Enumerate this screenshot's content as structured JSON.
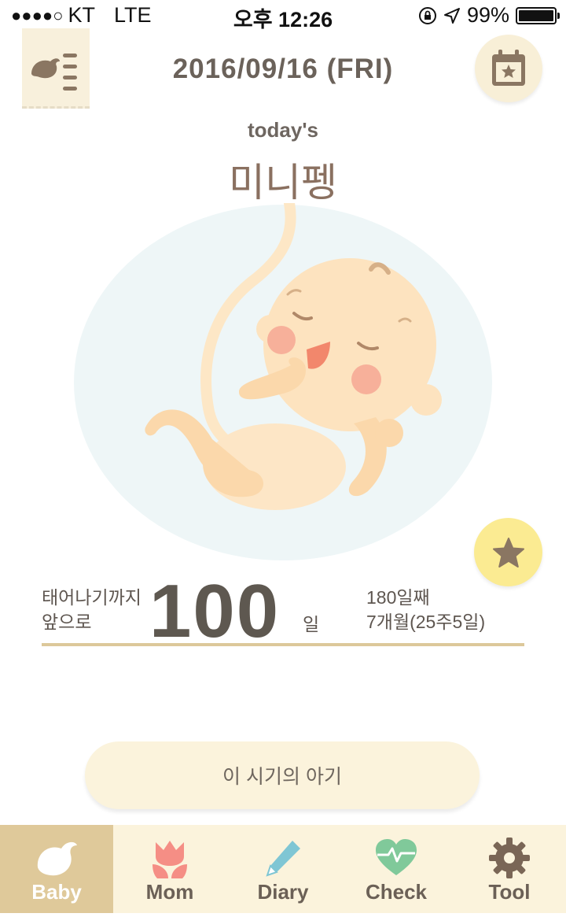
{
  "status_bar": {
    "signal": "●●●●○",
    "carrier": "KT",
    "network": "LTE",
    "time": "오후 12:26",
    "battery": "99%"
  },
  "header": {
    "date": "2016/09/16 (FRI)",
    "menu_icon": "bird-menu-icon",
    "calendar_icon": "calendar-star-icon"
  },
  "hero": {
    "todays_label": "today's",
    "baby_name": "미니펭"
  },
  "counter": {
    "left_line1": "태어나기까지",
    "left_line2": "앞으로",
    "value": "100",
    "unit": "일",
    "right_line1": "180일째",
    "right_line2": "7개월(25주5일)"
  },
  "info_button": "이 시기의 아기",
  "tabs": [
    {
      "label": "Baby",
      "icon": "bird-icon",
      "active": true
    },
    {
      "label": "Mom",
      "icon": "tulip-icon",
      "active": false
    },
    {
      "label": "Diary",
      "icon": "pencil-icon",
      "active": false
    },
    {
      "label": "Check",
      "icon": "heartbeat-icon",
      "active": false
    },
    {
      "label": "Tool",
      "icon": "gear-icon",
      "active": false
    }
  ],
  "colors": {
    "accent_beige": "#dfc99a",
    "cream": "#fbf3dc",
    "star_yellow": "#fbeb92",
    "text_brown": "#6b625a"
  }
}
